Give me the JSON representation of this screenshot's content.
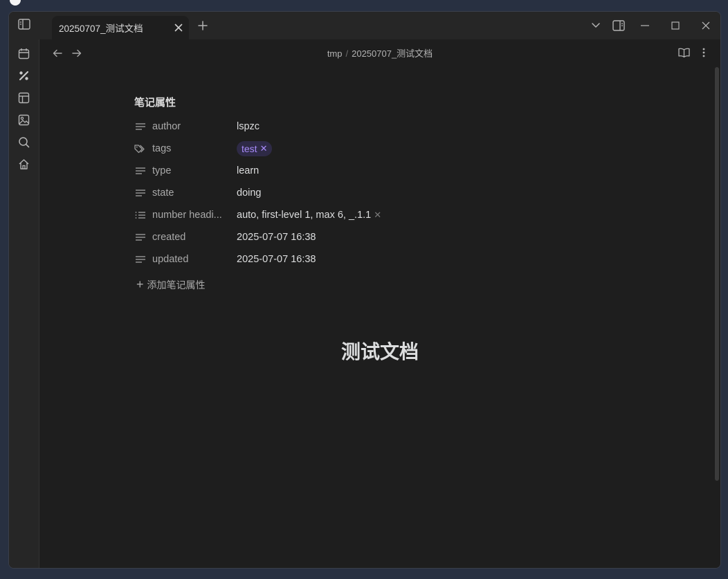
{
  "tab": {
    "title": "20250707_测试文档"
  },
  "breadcrumb": {
    "folder": "tmp",
    "separator": "/",
    "file": "20250707_测试文档"
  },
  "properties": {
    "title": "笔记属性",
    "rows": [
      {
        "key": "author",
        "value": "lspzc",
        "icon": "text-lines-icon"
      },
      {
        "key": "tags",
        "value": "test",
        "icon": "tags-icon"
      },
      {
        "key": "type",
        "value": "learn",
        "icon": "text-lines-icon"
      },
      {
        "key": "state",
        "value": "doing",
        "icon": "text-lines-icon"
      },
      {
        "key": "number headi...",
        "value": "auto, first-level 1, max 6, _.1.1",
        "icon": "list-icon"
      },
      {
        "key": "created",
        "value": "2025-07-07 16:38",
        "icon": "text-lines-icon"
      },
      {
        "key": "updated",
        "value": "2025-07-07 16:38",
        "icon": "text-lines-icon"
      }
    ],
    "add_label": "添加笔记属性"
  },
  "document": {
    "heading": "测试文档"
  },
  "colors": {
    "background": "#1e1e1e",
    "titlebar": "#262626",
    "tag_bg": "#2e2a46",
    "tag_text": "#a88bfa",
    "text": "#dcddde",
    "muted": "#a9a9a9"
  },
  "icons": {
    "ribbon": [
      "calendar-icon",
      "graph-brush-icon",
      "layout-icon",
      "image-icon",
      "search-icon",
      "home-icon"
    ],
    "titlebar": [
      "sidebar-toggle-icon",
      "close-icon",
      "plus-icon",
      "chevron-down-icon",
      "split-view-icon",
      "minimize-icon",
      "maximize-icon",
      "window-close-icon"
    ],
    "nav": [
      "arrow-left-icon",
      "arrow-right-icon",
      "reading-mode-icon",
      "more-options-icon"
    ]
  }
}
